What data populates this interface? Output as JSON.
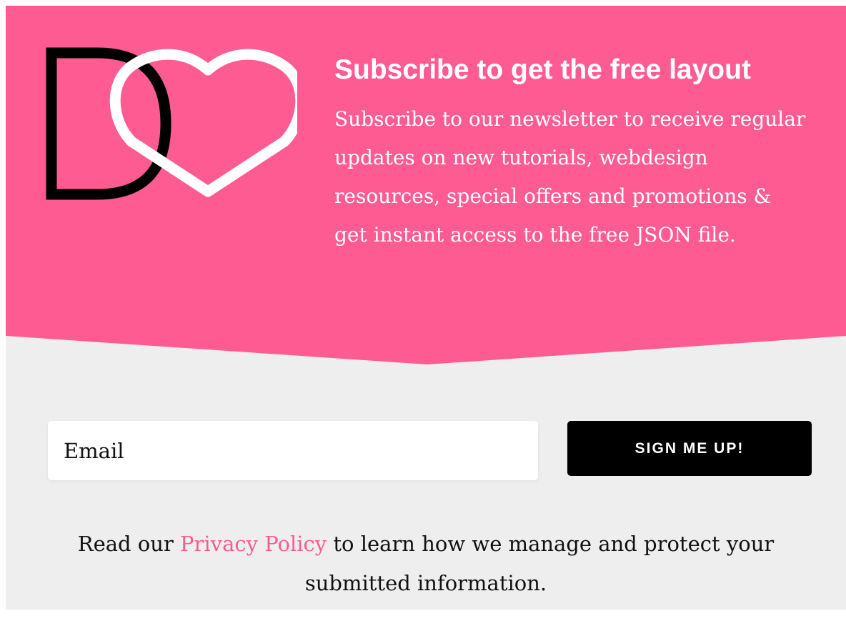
{
  "colors": {
    "accent": "#ff5b93",
    "panel_background": "#eeeeee",
    "button_background": "#000000",
    "text": "#111111"
  },
  "hero": {
    "logo_icon": "d-heart-logo",
    "headline": "Subscribe to get the free layout",
    "description": "Subscribe to our newsletter to receive regular updates on new tutorials, webdesign resources, special offers and promotions & get instant access to the free JSON file."
  },
  "form": {
    "email_placeholder": "Email",
    "email_value": "",
    "submit_label": "SIGN ME UP!"
  },
  "privacy": {
    "before": "Read our ",
    "link_label": "Privacy Policy",
    "after": " to learn how we manage and protect your submitted information."
  }
}
